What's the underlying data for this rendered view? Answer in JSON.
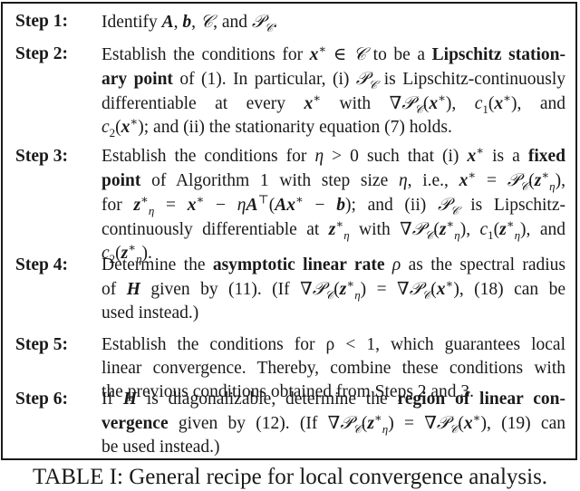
{
  "table": {
    "steps": [
      {
        "label": "Step 1:",
        "lines": [
          "Identify A, b, 𝒞, and 𝒫𝒞."
        ]
      },
      {
        "label": "Step 2:",
        "lines": [
          "Establish the conditions for x* ∈ 𝒞 to be a Lipschitz station-",
          "ary point of (1). In particular, (i) 𝒫𝒞 is Lipschitz-continuously",
          "differentiable at every x* with ∇𝒫𝒞(x*), c1(x*), and",
          "c2(x*); and (ii) the stationarity equation (7) holds."
        ],
        "bold_terms": [
          "Lipschitz station-",
          "ary point"
        ]
      },
      {
        "label": "Step 3:",
        "lines": [
          "Establish the conditions for η > 0 such that (i) x* is a fixed",
          "point of Algorithm 1 with step size η, i.e., x* = 𝒫𝒞(z*η),",
          "for z*η = x* − ηA⊤(Ax* − b); and (ii) 𝒫𝒞 is Lipschitz-",
          "continuously differentiable at z*η with ∇𝒫𝒞(z*η), c1(z*η), and",
          "c2(z*η)."
        ],
        "bold_terms": [
          "fixed",
          "point"
        ]
      },
      {
        "label": "Step 4:",
        "lines": [
          "Determine the asymptotic linear rate ρ as the spectral radius",
          "of H given by (11). (If ∇𝒫𝒞(z*η) = ∇𝒫𝒞(x*), (18) can be",
          "used instead.)"
        ],
        "bold_terms": [
          "asymptotic linear rate"
        ]
      },
      {
        "label": "Step 5:",
        "lines": [
          "Establish the conditions for ρ < 1, which guarantees local",
          "linear convergence. Thereby, combine these conditions with",
          "the previous conditions obtained from Steps 2 and 3."
        ]
      },
      {
        "label": "Step 6:",
        "lines": [
          "If H is diagonalizable, determine the region of linear con-",
          "vergence given by (12). (If ∇𝒫𝒞(z*η) = ∇𝒫𝒞(x*), (19) can",
          "be used instead.)"
        ],
        "bold_terms": [
          "region of linear con-",
          "vergence"
        ]
      }
    ]
  },
  "caption": "TABLE I: General recipe for local convergence analysis."
}
